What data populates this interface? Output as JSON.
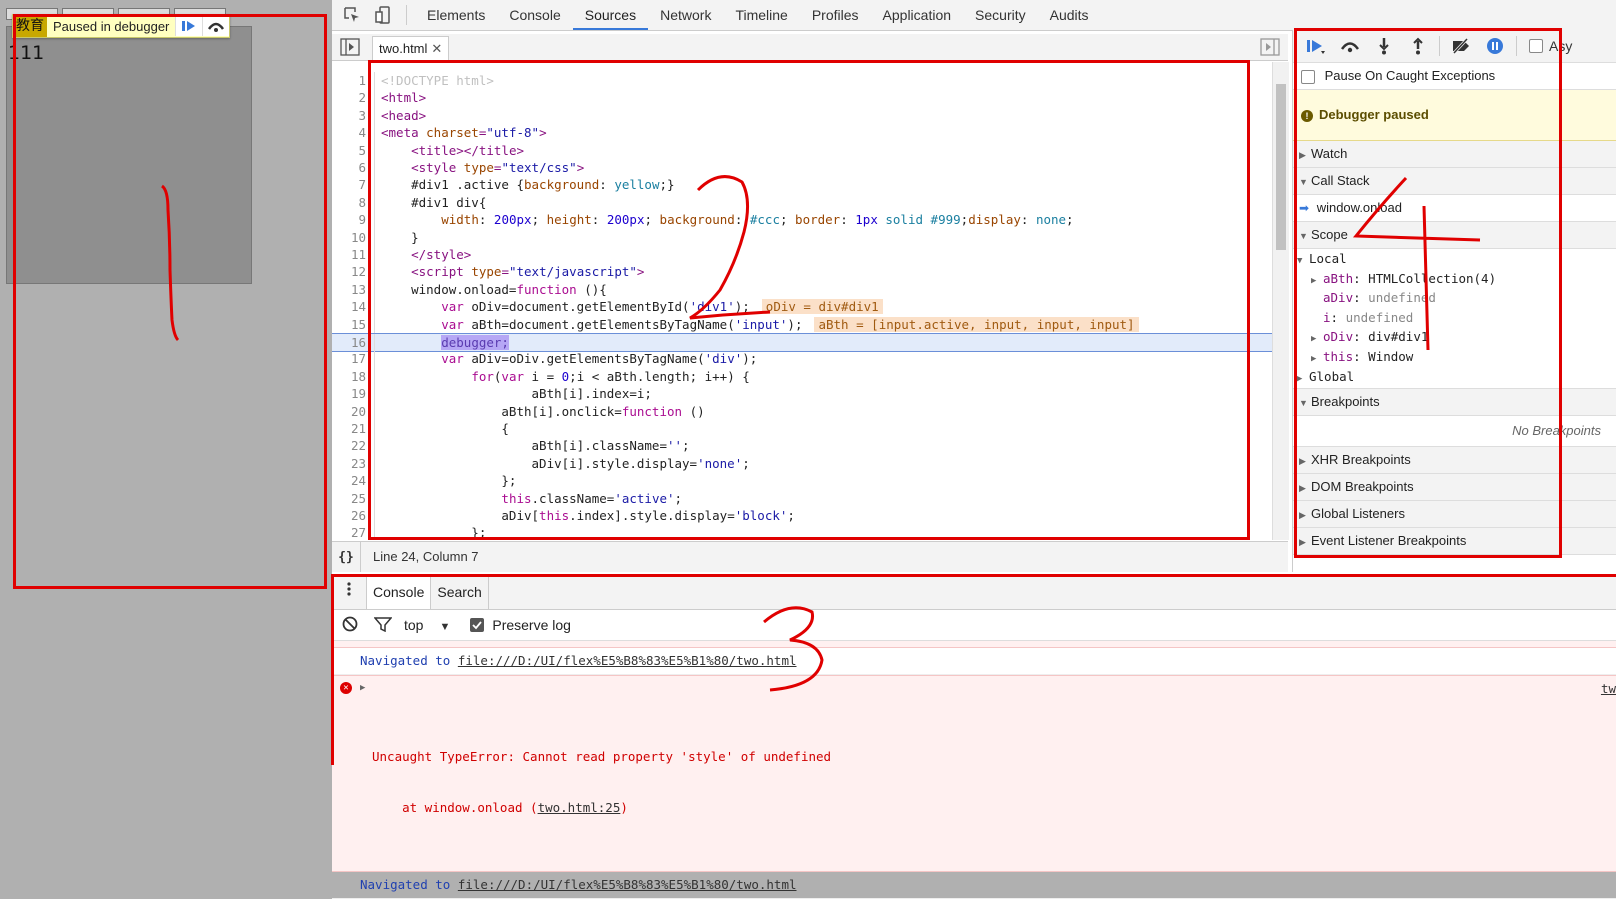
{
  "page_preview": {
    "text": "111",
    "paused_bar": {
      "brand": "教育",
      "label": "Paused in debugger"
    }
  },
  "devtools": {
    "tabs": [
      "Elements",
      "Console",
      "Sources",
      "Network",
      "Timeline",
      "Profiles",
      "Application",
      "Security",
      "Audits"
    ],
    "active_tab": "Sources",
    "accent_color": "#3879d9"
  },
  "sources": {
    "file_tab": "two.html",
    "status": "Line 24, Column 7",
    "format_label": "{}"
  },
  "code_lines": [
    {
      "n": "1",
      "html": "<span class='t-doc'>&lt;!DOCTYPE html&gt;</span>"
    },
    {
      "n": "2",
      "html": "<span class='t-tag'>&lt;html&gt;</span>"
    },
    {
      "n": "3",
      "html": "<span class='t-tag'>&lt;head&gt;</span>"
    },
    {
      "n": "4",
      "html": "<span class='t-tag'>&lt;meta </span><span class='t-attr'>charset</span><span class='t-tag'>=</span><span class='t-str'>\"utf-8\"</span><span class='t-tag'>&gt;</span>"
    },
    {
      "n": "5",
      "html": "    <span class='t-tag'>&lt;title&gt;&lt;/title&gt;</span>"
    },
    {
      "n": "6",
      "html": "    <span class='t-tag'>&lt;style </span><span class='t-attr'>type</span><span class='t-tag'>=</span><span class='t-str'>\"text/css\"</span><span class='t-tag'>&gt;</span>"
    },
    {
      "n": "7",
      "html": "    #div1 .active {<span class='t-attr'>background</span>: <span class='t-val'>yellow</span>;}"
    },
    {
      "n": "8",
      "html": "    #div1 div{"
    },
    {
      "n": "9",
      "html": "        <span class='t-attr'>width</span>: <span class='t-num'>200px</span>; <span class='t-attr'>height</span>: <span class='t-num'>200px</span>; <span class='t-attr'>background</span>: <span class='t-val'>#ccc</span>; <span class='t-attr'>border</span>: <span class='t-num'>1px</span> <span class='t-val'>solid</span> <span class='t-val'>#999</span>;<span class='t-attr'>display</span>: <span class='t-val'>none</span>;"
    },
    {
      "n": "10",
      "html": "    }"
    },
    {
      "n": "11",
      "html": "    <span class='t-tag'>&lt;/style&gt;</span>"
    },
    {
      "n": "12",
      "html": "    <span class='t-tag'>&lt;script </span><span class='t-attr'>type</span><span class='t-tag'>=</span><span class='t-str'>\"text/javascript\"</span><span class='t-tag'>&gt;</span>"
    },
    {
      "n": "13",
      "html": "    window.onload=<span class='t-kw'>function</span> (){"
    },
    {
      "n": "14",
      "html": "        <span class='t-kw'>var</span> oDiv=document.getElementById(<span class='t-str'>'div1'</span>);<span class='inl'>oDiv = div#div1</span>"
    },
    {
      "n": "15",
      "html": "        <span class='t-kw'>var</span> aBth=document.getElementsByTagName(<span class='t-str'>'input'</span>);<span class='inl'>aBth = [input.active, input, input, input]</span>"
    },
    {
      "n": "16",
      "html": "        <span class='t-dbg'>debugger;</span>",
      "current": true
    },
    {
      "n": "17",
      "html": "        <span class='t-kw'>var</span> aDiv=oDiv.getElementsByTagName(<span class='t-str'>'div'</span>);"
    },
    {
      "n": "18",
      "html": "            <span class='t-kw'>for</span>(<span class='t-kw'>var</span> i = <span class='t-num'>0</span>;i &lt; aBth.length; i++) {"
    },
    {
      "n": "19",
      "html": "                    aBth[i].index=i;"
    },
    {
      "n": "20",
      "html": "                aBth[i].onclick=<span class='t-kw'>function</span> ()"
    },
    {
      "n": "21",
      "html": "                {"
    },
    {
      "n": "22",
      "html": "                    aBth[i].className=<span class='t-str'>''</span>;"
    },
    {
      "n": "23",
      "html": "                    aDiv[i].style.display=<span class='t-str'>'none'</span>;"
    },
    {
      "n": "24",
      "html": "                };"
    },
    {
      "n": "25",
      "html": "                <span class='t-kw'>this</span>.className=<span class='t-str'>'active'</span>;"
    },
    {
      "n": "26",
      "html": "                aDiv[<span class='t-kw'>this</span>.index].style.display=<span class='t-str'>'block'</span>;"
    },
    {
      "n": "27",
      "html": "            };"
    }
  ],
  "sidebar": {
    "toolbar_extra": "Asy",
    "pause_caught": "Pause On Caught Exceptions",
    "paused_msg": "Debugger paused",
    "watch": "Watch",
    "call_stack": "Call Stack",
    "call_frame": "window.onload",
    "scope": "Scope",
    "local": "Local",
    "scope_items": [
      {
        "key": "aBth",
        "val": "HTMLCollection(4)",
        "expand": true,
        "undef": false
      },
      {
        "key": "aDiv",
        "val": "undefined",
        "expand": false,
        "undef": true
      },
      {
        "key": "i",
        "val": "undefined",
        "expand": false,
        "undef": true
      },
      {
        "key": "oDiv",
        "val": "div#div1",
        "expand": true,
        "undef": false
      },
      {
        "key": "this",
        "val": "Window",
        "expand": true,
        "undef": false
      }
    ],
    "global": "Global",
    "breakpoints": "Breakpoints",
    "no_breakpoints": "No Breakpoints",
    "xhr": "XHR Breakpoints",
    "dom": "DOM Breakpoints",
    "global_listeners": "Global Listeners",
    "event_listeners": "Event Listener Breakpoints"
  },
  "console": {
    "tab_console": "Console",
    "tab_search": "Search",
    "context": "top",
    "preserve_log": "Preserve log",
    "nav1_prefix": "Navigated to ",
    "nav1_url": "file:///D:/UI/flex%E5%B8%83%E5%B1%80/two.html",
    "err_line1": "Uncaught TypeError: Cannot read property 'style' of undefined",
    "err_line2_prefix": "    at window.onload (",
    "err_line2_link": "two.html:25",
    "err_line2_suffix": ")",
    "err_source": "tw",
    "nav2_prefix": "Navigated to ",
    "nav2_url": "file:///D:/UI/flex%E5%B8%83%E5%B1%80/two.html"
  },
  "annotation_color": "#e00000"
}
